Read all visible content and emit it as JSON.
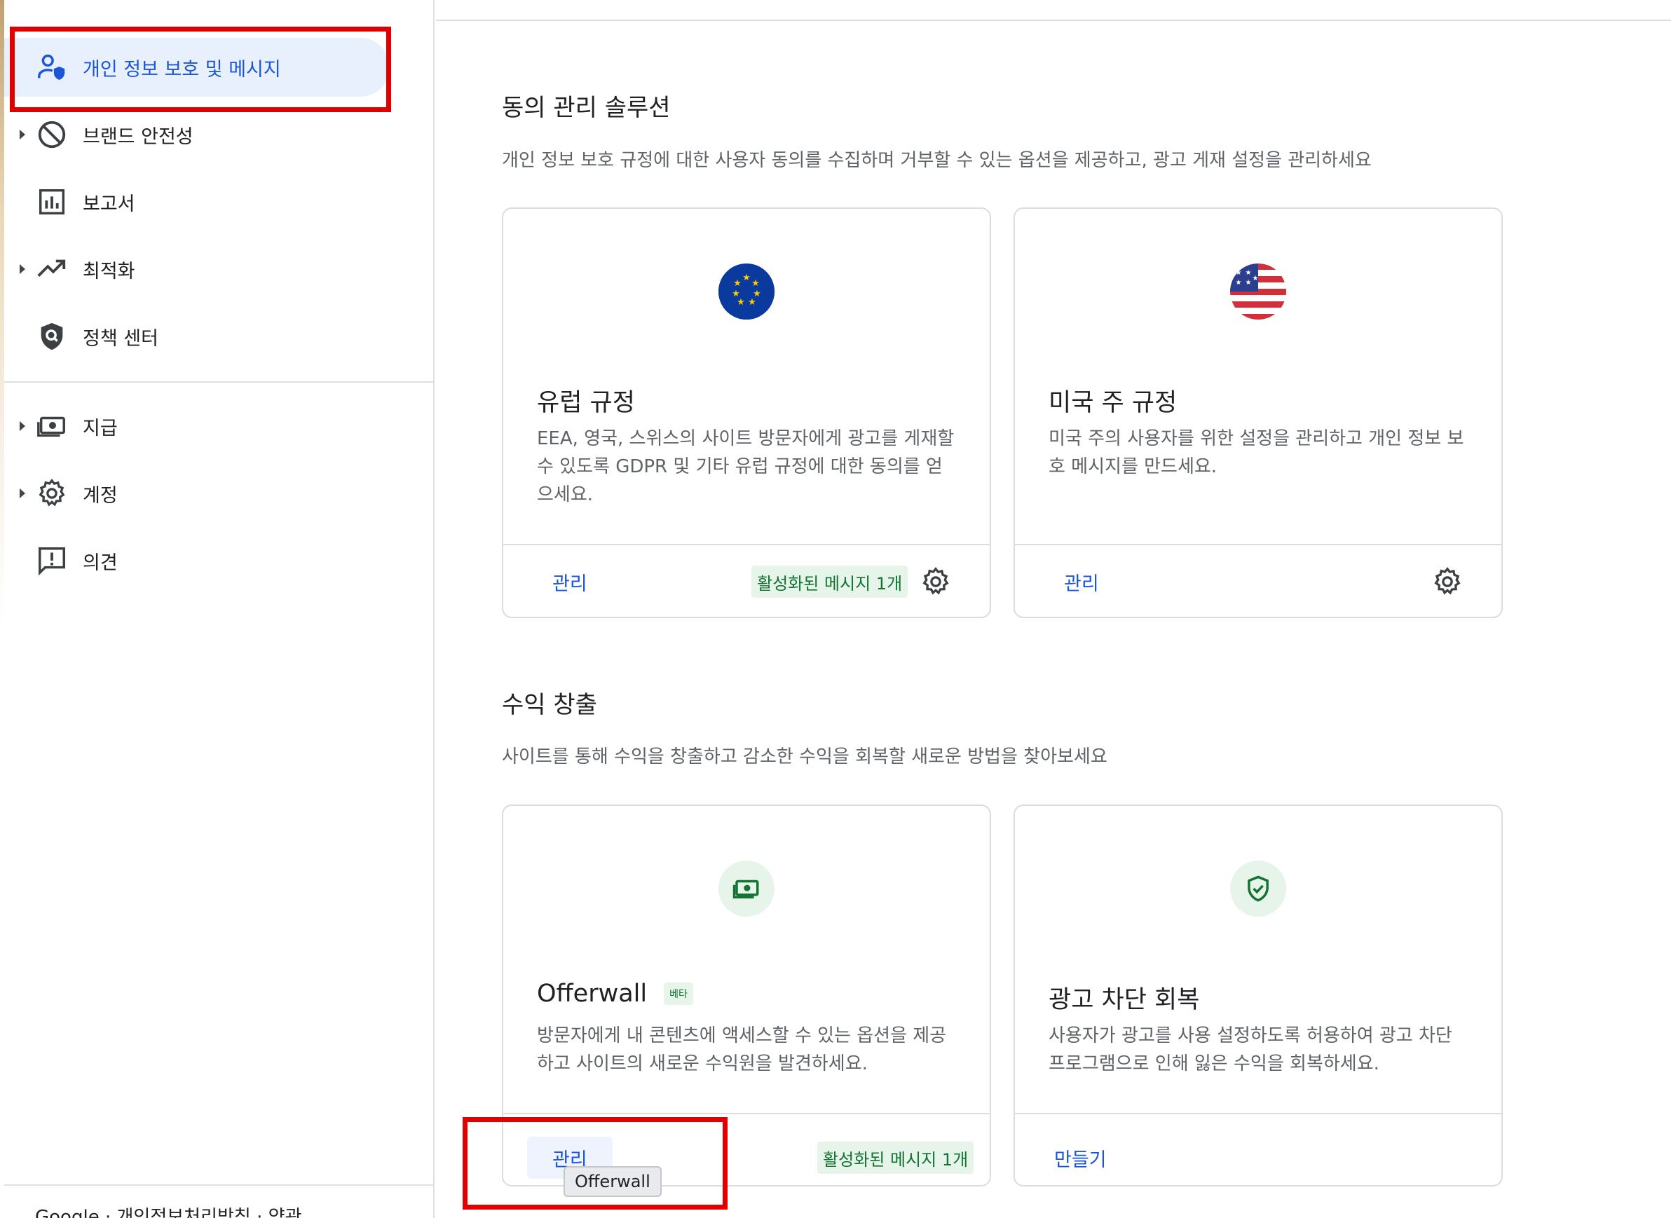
{
  "sidebar": {
    "items": [
      {
        "label": "개인 정보 보호 및 메시지",
        "icon": "privacy-person-shield-icon",
        "active": true,
        "expandable": false
      },
      {
        "label": "브랜드 안전성",
        "icon": "block-icon",
        "active": false,
        "expandable": true
      },
      {
        "label": "보고서",
        "icon": "bar-chart-icon",
        "active": false,
        "expandable": false
      },
      {
        "label": "최적화",
        "icon": "trending-up-icon",
        "active": false,
        "expandable": true
      },
      {
        "label": "정책 센터",
        "icon": "shield-search-icon",
        "active": false,
        "expandable": false
      },
      {
        "label": "지급",
        "icon": "payments-icon",
        "active": false,
        "expandable": true
      },
      {
        "label": "계정",
        "icon": "gear-icon",
        "active": false,
        "expandable": true
      },
      {
        "label": "의견",
        "icon": "feedback-icon",
        "active": false,
        "expandable": false
      }
    ],
    "footer": "Google · 개인정보처리방침 · 약관"
  },
  "consent": {
    "title": "동의 관리 솔루션",
    "description": "개인 정보 보호 규정에 대한 사용자 동의를 수집하며 거부할 수 있는 옵션을 제공하고, 광고 게재 설정을 관리하세요",
    "cards": [
      {
        "title": "유럽 규정",
        "description": "EEA, 영국, 스위스의 사이트 방문자에게 광고를 게재할 수 있도록 GDPR 및 기타 유럽 규정에 대한 동의를 얻으세요.",
        "manage": "관리",
        "status": "활성화된 메시지 1개",
        "icon": "eu-flag-icon"
      },
      {
        "title": "미국 주 규정",
        "description": "미국 주의 사용자를 위한 설정을 관리하고 개인 정보 보호 메시지를 만드세요.",
        "manage": "관리",
        "status": "",
        "icon": "us-flag-icon"
      }
    ]
  },
  "monetization": {
    "title": "수익 창출",
    "description": "사이트를 통해 수익을 창출하고 감소한 수익을 회복할 새로운 방법을 찾아보세요",
    "cards": [
      {
        "title": "Offerwall",
        "badge": "베타",
        "description": "방문자에게 내 콘텐츠에 액세스할 수 있는 옵션을 제공하고 사이트의 새로운 수익원을 발견하세요.",
        "manage": "관리",
        "status": "활성화된 메시지 1개",
        "tooltip": "Offerwall",
        "icon": "money-icon"
      },
      {
        "title": "광고 차단 회복",
        "description": "사용자가 광고를 사용 설정하도록 허용하여 광고 차단 프로그램으로 인해 잃은 수익을 회복하세요.",
        "manage": "만들기",
        "icon": "shield-check-icon"
      }
    ]
  },
  "colors": {
    "accent": "#1a56d6",
    "active_bg": "#e8f0fe",
    "status_bg": "#e6f4ea",
    "status_text": "#137333",
    "annotation": "#e00000"
  }
}
